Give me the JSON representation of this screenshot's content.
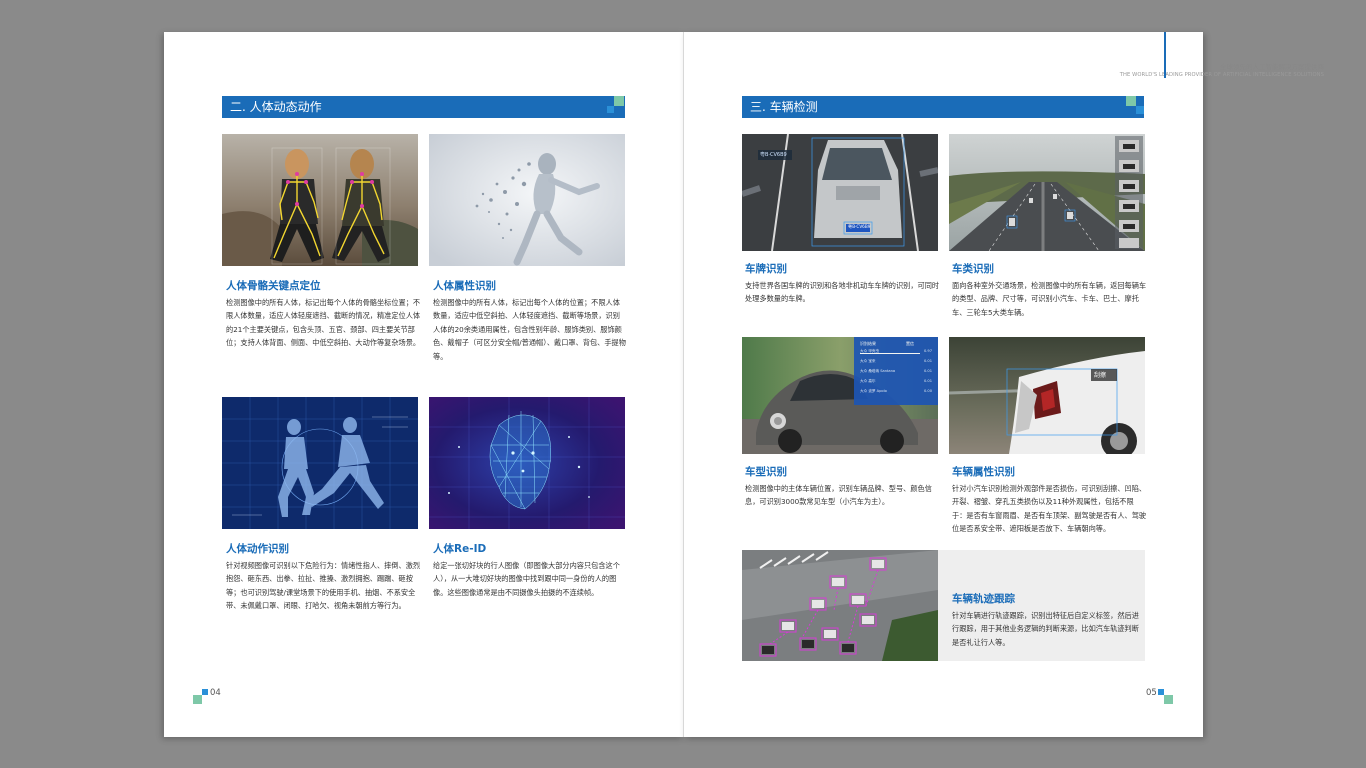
{
  "left_page": {
    "section_title": "二. 人体动态动作",
    "page_number": "04",
    "items": [
      {
        "title": "人体骨骼关键点定位",
        "text": "检测图像中的所有人体，标记出每个人体的骨骼坐标位置；不限人体数量，适应人体轻度遮挡、截断的情况，精准定位人体的21个主要关键点，包含头顶、五官、颈部、四主要关节部位；支持人体背面、侧面、中低空斜拍、大动作等复杂场景。"
      },
      {
        "title": "人体属性识别",
        "text": "检测图像中的所有人体，标记出每个人体的位置；不限人体数量，适应中低空斜拍、人体轻度遮挡、截断等场景，识别人体的20余类通用属性，包含性别年龄、服饰类别、服饰颜色、戴帽子（可区分安全帽/普通帽）、戴口罩、背包、手提物等。"
      },
      {
        "title": "人体动作识别",
        "text": "针对视频图像可识别以下危险行为：情绪性指人、摔倒、激烈抱怨、砸东西、出拳、拉扯、推搡、激烈拥抱、踢踹、砸按等；也可识别驾驶/课堂场景下的使用手机、抽烟、不系安全带、未佩戴口罩、闭眼、打哈欠、视角未朝前方等行为。"
      },
      {
        "title": "人体Re-ID",
        "text": "给定一张切好块的行人图像（即图像大部分内容只包含这个人），从一大堆切好块的图像中找到跟中同一身份的人的图像。这些图像通常是由不同摄像头拍摄的不连续帧。"
      }
    ]
  },
  "right_page": {
    "header_cn": "全球领先的人工智能解决方案提供商",
    "header_en": "THE WORLD'S LEADING PROVIDER OF ARTIFICIAL INTELLIGENCE SOLUTIONS",
    "section_title": "三. 车辆检测",
    "page_number": "05",
    "plate_label": "粤B·CV6B9",
    "car_plate": "粤B·CV6B9",
    "damage_label": "刮擦",
    "car_panel": {
      "header": [
        "识别结果",
        "置信"
      ],
      "rows": [
        [
          "大众 甲壳虫",
          "0.97"
        ],
        [
          "大众 宝来",
          "0.01"
        ],
        [
          "大众 桑塔纳 Santana",
          "0.01"
        ],
        [
          "大众 高尔",
          "0.01"
        ],
        [
          "大众 波罗 Apolo",
          "0.00"
        ]
      ]
    },
    "items": [
      {
        "title": "车牌识别",
        "text": "支持世界各国车牌的识别和各地非机动车车牌的识别，可同时处理多数量的车牌。"
      },
      {
        "title": "车类识别",
        "text": "面向各种室外交通场景，检测图像中的所有车辆，返回每辆车的类型、品牌、尺寸等，可识别小汽车、卡车、巴士、摩托车、三轮车5大类车辆。"
      },
      {
        "title": "车型识别",
        "text": "检测图像中的主体车辆位置，识别车辆品牌、型号、颜色信息，可识别3000款常见车型（小汽车为主）。"
      },
      {
        "title": "车辆属性识别",
        "text": "针对小汽车识别检测外观部件是否损伤，可识别刮擦、凹陷、开裂、褶皱、穿孔五类损伤以及11种外观属性，包括不限于：是否有车窗雨眉、是否有车顶架、副驾驶是否有人、驾驶位是否系安全带、遮阳板是否放下、车辆朝向等。"
      },
      {
        "title": "车辆轨迹跟踪",
        "text": "针对车辆进行轨迹跟踪，识别出特征后自定义标签，然后进行跟踪，用于其他业务逻辑的判断来源，比如汽车轨迹判断是否礼让行人等。"
      }
    ]
  },
  "colors": {
    "brand_blue": "#1a6cb8",
    "accent_green": "#7ec8a8",
    "text_dark": "#333333"
  }
}
